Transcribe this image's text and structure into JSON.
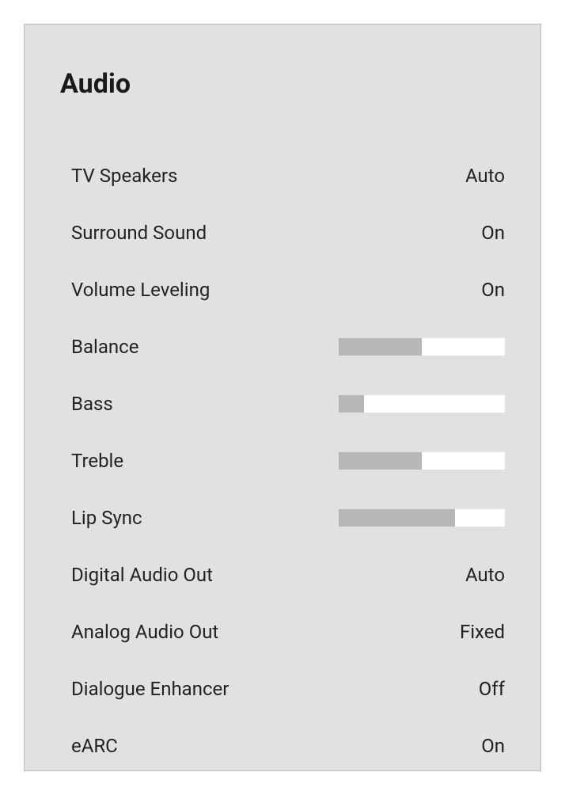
{
  "title": "Audio",
  "settings": {
    "tv_speakers": {
      "label": "TV Speakers",
      "value": "Auto"
    },
    "surround_sound": {
      "label": "Surround Sound",
      "value": "On"
    },
    "volume_leveling": {
      "label": "Volume Leveling",
      "value": "On"
    },
    "balance": {
      "label": "Balance",
      "percent": 50
    },
    "bass": {
      "label": "Bass",
      "percent": 15
    },
    "treble": {
      "label": "Treble",
      "percent": 50
    },
    "lip_sync": {
      "label": "Lip Sync",
      "percent": 70
    },
    "digital_audio_out": {
      "label": "Digital Audio Out",
      "value": "Auto"
    },
    "analog_audio_out": {
      "label": "Analog Audio Out",
      "value": "Fixed"
    },
    "dialogue_enhancer": {
      "label": "Dialogue Enhancer",
      "value": "Off"
    },
    "earc": {
      "label": "eARC",
      "value": "On"
    }
  }
}
